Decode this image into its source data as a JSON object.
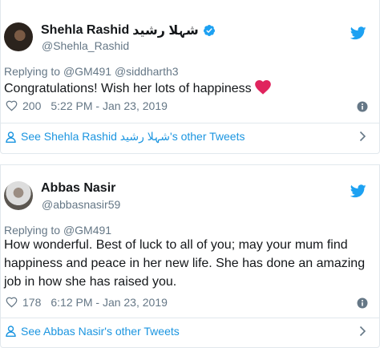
{
  "tweets": [
    {
      "display_name": "Shehla Rashid",
      "display_name_urdu": "شہلا رشید",
      "handle": "@Shehla_Rashid",
      "verified": true,
      "replying_label": "Replying to",
      "replying_to": "@GM491 @siddharth3",
      "text": "Congratulations! Wish her lots of happiness",
      "emoji": "red-heart",
      "likes": "200",
      "timestamp": "5:22 PM - Jan 23, 2019",
      "other_tweets_link": "See Shehla Rashid شہلا رشید's other Tweets"
    },
    {
      "display_name": "Abbas Nasir",
      "handle": "@abbasnasir59",
      "verified": false,
      "replying_label": "Replying to",
      "replying_to": "@GM491",
      "text": "How wonderful. Best of luck to all of you; may your mum find happiness and peace in her new life. She has done an amazing job in how she has raised you.",
      "likes": "178",
      "timestamp": "6:12 PM - Jan 23, 2019",
      "other_tweets_link": "See Abbas Nasir's other Tweets"
    }
  ],
  "colors": {
    "twitter_blue": "#1da1f2",
    "link_blue": "#1b95e0",
    "secondary_text": "#657786",
    "heart_red": "#e0245e",
    "border": "#e1e8ed"
  },
  "icons": [
    "avatar",
    "verified-badge-icon",
    "twitter-bird-icon",
    "heart-icon",
    "info-icon",
    "person-icon",
    "chevron-right-icon"
  ]
}
